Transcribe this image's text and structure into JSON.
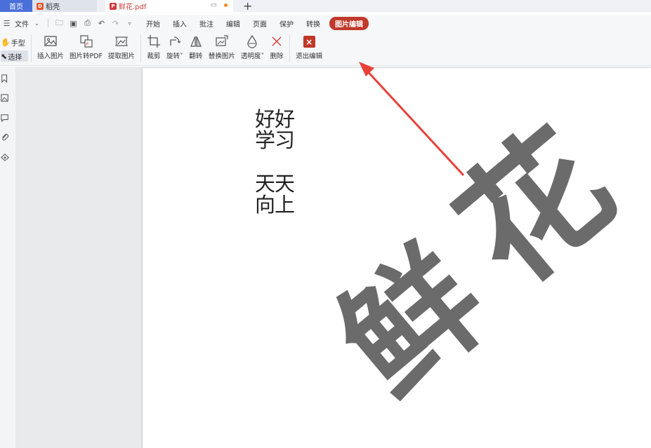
{
  "tabs": {
    "home": "首页",
    "daoke": "稻壳",
    "pdf": "鲜花.pdf"
  },
  "menu": {
    "file": "文件",
    "items": [
      "开始",
      "插入",
      "批注",
      "编辑",
      "页面",
      "保护",
      "转换"
    ],
    "active": "图片编辑"
  },
  "modes": {
    "hand": "手型",
    "select": "选择"
  },
  "tools": {
    "insert_image": "插入图片",
    "image_to_pdf": "图片转PDF",
    "extract_image": "提取图片",
    "crop": "裁剪",
    "rotate": "旋转",
    "flip": "翻转",
    "replace_image": "替换图片",
    "opacity": "透明度",
    "delete": "删除",
    "exit_edit": "退出编辑"
  },
  "document": {
    "poem_lines": [
      "好好",
      "学习",
      "天天",
      "向上"
    ],
    "watermark_char1": "鲜",
    "watermark_char2": "花"
  },
  "colors": {
    "accent": "#c0392b",
    "home_tab": "#4a6fd9",
    "arrow": "#e8413a"
  }
}
